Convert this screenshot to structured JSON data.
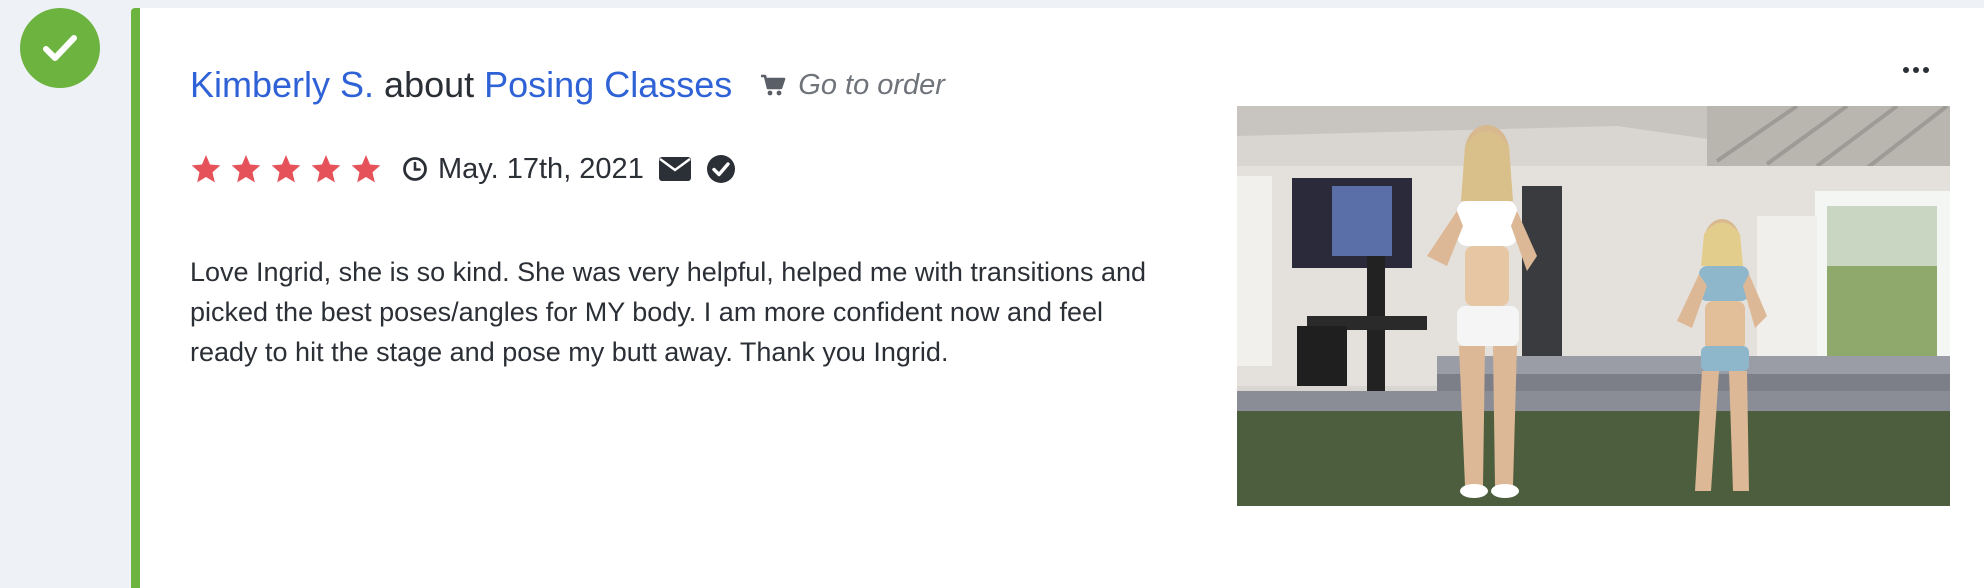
{
  "status": {
    "icon": "check-icon",
    "color": "#6cb33f"
  },
  "review": {
    "author": "Kimberly S.",
    "about_label": "about",
    "product": "Posing Classes",
    "order_link": "Go to order",
    "rating": 5,
    "max_rating": 5,
    "date": "May. 17th, 2021",
    "body": "Love Ingrid, she is so kind. She was very helpful, helped me with transitions and picked the best poses/angles for MY body. I am more confident now and feel ready to hit the stage and pose my butt away. Thank you Ingrid.",
    "icons": [
      "clock-icon",
      "envelope-icon",
      "verified-check-icon",
      "cart-icon",
      "more-options-icon"
    ]
  },
  "colors": {
    "accent_green": "#6cb33f",
    "link_blue": "#2f62d6",
    "star_red": "#e5525a",
    "text_dark": "#2b2f36",
    "muted": "#6f737a"
  }
}
